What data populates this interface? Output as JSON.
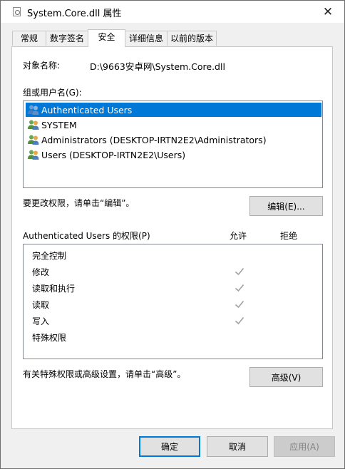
{
  "window": {
    "title": "System.Core.dll 属性",
    "close_glyph": "✕"
  },
  "tabs": [
    {
      "label": "常规"
    },
    {
      "label": "数字签名"
    },
    {
      "label": "安全"
    },
    {
      "label": "详细信息"
    },
    {
      "label": "以前的版本"
    }
  ],
  "object": {
    "label": "对象名称:",
    "value": "D:\\9663安卓网\\System.Core.dll"
  },
  "groups": {
    "label": "组或用户名(G):",
    "items": [
      {
        "name": "Authenticated Users",
        "selected": true
      },
      {
        "name": "SYSTEM",
        "selected": false
      },
      {
        "name": "Administrators (DESKTOP-IRTN2E2\\Administrators)",
        "selected": false
      },
      {
        "name": "Users (DESKTOP-IRTN2E2\\Users)",
        "selected": false
      }
    ]
  },
  "edit": {
    "hint": "要更改权限，请单击“编辑”。",
    "button": "编辑(E)..."
  },
  "permissions": {
    "header": "Authenticated Users 的权限(P)",
    "allow_header": "允许",
    "deny_header": "拒绝",
    "rows": [
      {
        "name": "完全控制",
        "allow": false,
        "deny": false
      },
      {
        "name": "修改",
        "allow": true,
        "deny": false
      },
      {
        "name": "读取和执行",
        "allow": true,
        "deny": false
      },
      {
        "name": "读取",
        "allow": true,
        "deny": false
      },
      {
        "name": "写入",
        "allow": true,
        "deny": false
      },
      {
        "name": "特殊权限",
        "allow": false,
        "deny": false
      }
    ]
  },
  "advanced": {
    "hint": "有关特殊权限或高级设置，请单击“高级”。",
    "button": "高级(V)"
  },
  "footer": {
    "ok": "确定",
    "cancel": "取消",
    "apply": "应用(A)"
  },
  "colors": {
    "selection": "#0078d7",
    "check": "#a0a0a0"
  }
}
